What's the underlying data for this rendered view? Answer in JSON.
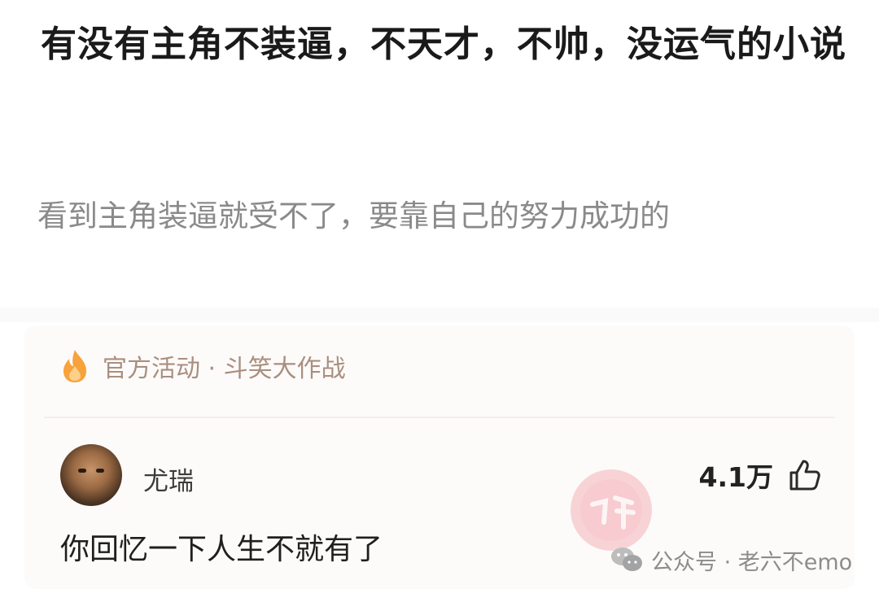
{
  "question": {
    "title": "有没有主角不装逼，不天才，不帅，没运气的小说",
    "description": "看到主角装逼就受不了，要靠自己的努力成功的"
  },
  "activity": {
    "icon": "flame-icon",
    "label": "官方活动 · 斗笑大作战"
  },
  "answer": {
    "author": "尤瑞",
    "like_count": "4.1万",
    "like_icon": "thumbs-up-icon",
    "content": "你回忆一下人生不就有了"
  },
  "watermark": {
    "seal_color": "#f2a6ad",
    "wechat_label": "公众号 · 老六不emo"
  },
  "colors": {
    "activity_text": "#a98f7f",
    "flame_orange": "#f7a23b",
    "description_gray": "#8a8a8a"
  }
}
